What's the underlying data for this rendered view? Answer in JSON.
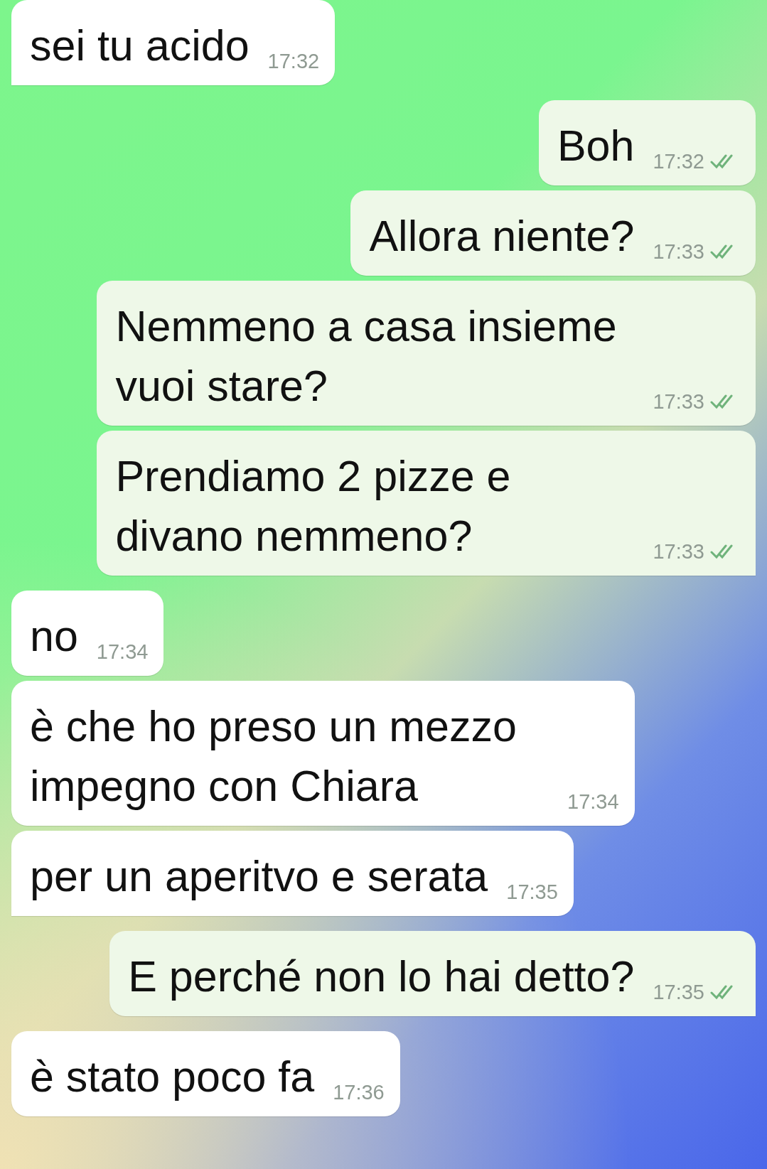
{
  "messages": [
    {
      "kind": "in",
      "text": "sei tu acido",
      "time": "17:32",
      "tail": true
    },
    {
      "kind": "out",
      "text": "Boh",
      "time": "17:32",
      "tail": false
    },
    {
      "kind": "out",
      "text": "Allora niente?",
      "time": "17:33",
      "tail": false
    },
    {
      "kind": "out",
      "text": "Nemmeno a casa insieme vuoi stare?",
      "time": "17:33",
      "tail": false
    },
    {
      "kind": "out",
      "text": "Prendiamo 2 pizze e divano nemmeno?",
      "time": "17:33",
      "tail": true
    },
    {
      "kind": "in",
      "text": "no",
      "time": "17:34",
      "tail": false
    },
    {
      "kind": "in",
      "text": "è che ho preso un mezzo impegno con Chiara",
      "time": "17:34",
      "tail": false
    },
    {
      "kind": "in",
      "text": "per un aperitvo e serata",
      "time": "17:35",
      "tail": true
    },
    {
      "kind": "out",
      "text": "E perché non lo hai detto?",
      "time": "17:35",
      "tail": true
    },
    {
      "kind": "in",
      "text": "è stato poco fa",
      "time": "17:36",
      "tail": false
    }
  ]
}
